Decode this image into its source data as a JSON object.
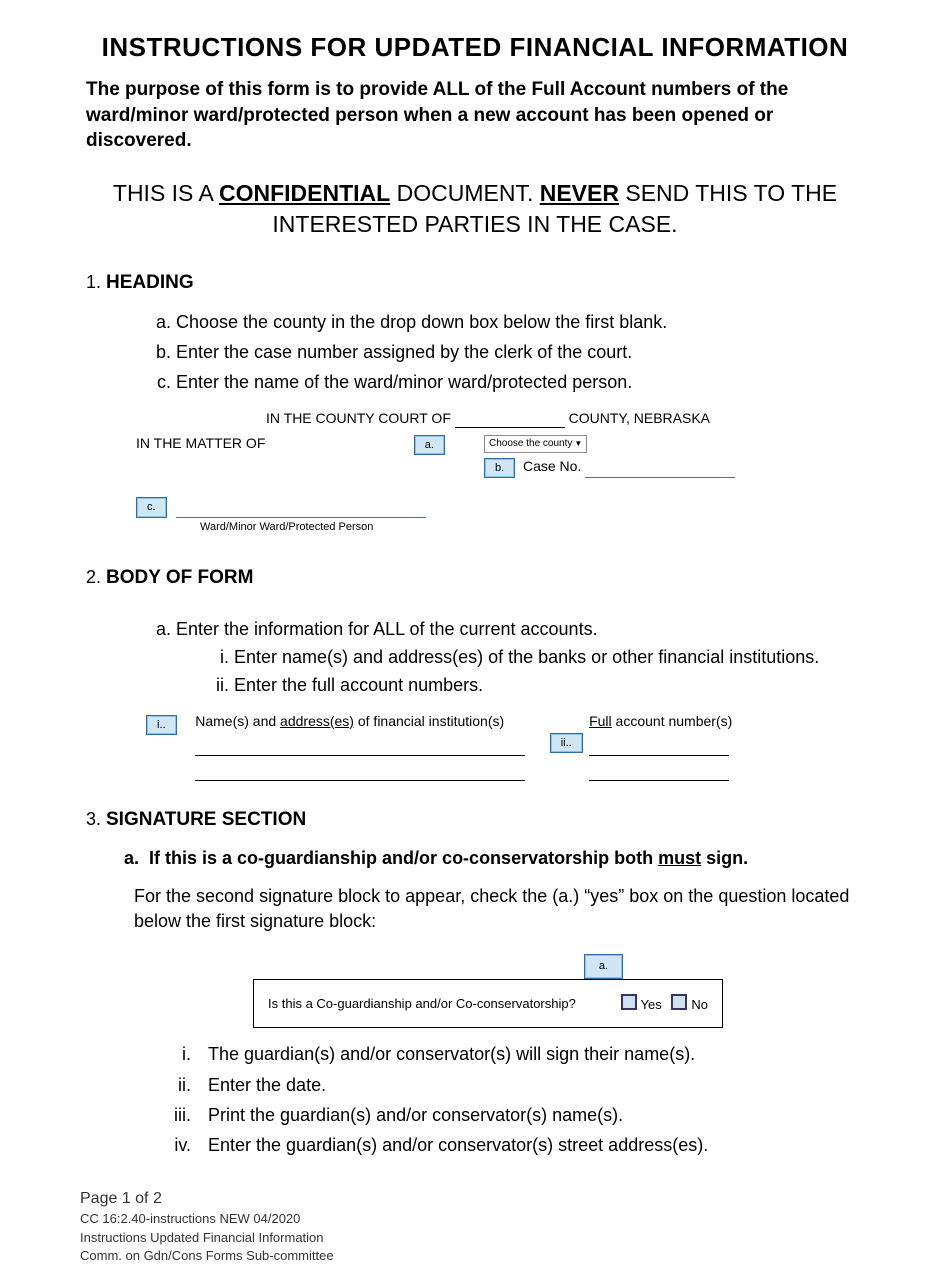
{
  "title": "INSTRUCTIONS FOR UPDATED FINANCIAL INFORMATION",
  "purpose": "The purpose of this form is to provide ALL of the Full Account numbers of the ward/minor ward/protected person when a new account has been opened or discovered.",
  "confidential": {
    "pre": "THIS IS A ",
    "conf": "CONFIDENTIAL",
    "mid": " DOCUMENT.  ",
    "never": "NEVER",
    "post": " SEND THIS TO THE INTERESTED PARTIES IN THE CASE."
  },
  "sections": {
    "s1": {
      "title": "HEADING",
      "a": "Choose the county in the drop down box below the first blank.",
      "b": "Enter the case number assigned by the clerk of the court.",
      "c": "Enter the name of the ward/minor ward/protected person."
    },
    "s2": {
      "title": "BODY OF FORM",
      "a": "Enter the information for ALL of the current accounts.",
      "i": "Enter name(s) and address(es) of the banks or other financial institutions.",
      "ii": "Enter the full account numbers."
    },
    "s3": {
      "title": "SIGNATURE SECTION",
      "sub_a_pre": "If this is a co-guardianship and/or co-conservatorship both ",
      "sub_a_must": "must",
      "sub_a_post": " sign.",
      "para": "For the second signature block to appear, check the (a.) “yes” box on the question located below the first signature block:",
      "i": "The guardian(s) and/or conservator(s) will sign their name(s).",
      "ii": "Enter the date.",
      "iii": "Print the guardian(s) and/or conservator(s) name(s).",
      "iv": "Enter the guardian(s) and/or conservator(s) street address(es)."
    }
  },
  "diagram": {
    "heading": {
      "line1a": "IN THE  COUNTY  COURT  OF",
      "line1b": "COUNTY, NEBRASKA",
      "matter": "IN THE MATTER OF",
      "county_select": "Choose the county",
      "case_no": "Case No.",
      "protected_caption": "Ward/Minor Ward/Protected Person",
      "tags": {
        "a": "a.",
        "b": "b.",
        "c": "c."
      }
    },
    "body": {
      "col1": "Name(s) and address(es) of financial institution(s)",
      "col1_u1": "address(es)",
      "col2": "Full account number(s)",
      "col2_u": "Full",
      "tags": {
        "i": "i..",
        "ii": "ii.."
      }
    },
    "sig": {
      "question": "Is this a Co-guardianship and/or Co-conservatorship?",
      "yes": "Yes",
      "no": "No",
      "tag": "a."
    }
  },
  "footer": {
    "page": "Page 1 of 2",
    "l1": "CC 16:2.40-instructions NEW 04/2020",
    "l2": "Instructions Updated Financial Information",
    "l3": "Comm. on Gdn/Cons Forms Sub-committee"
  }
}
